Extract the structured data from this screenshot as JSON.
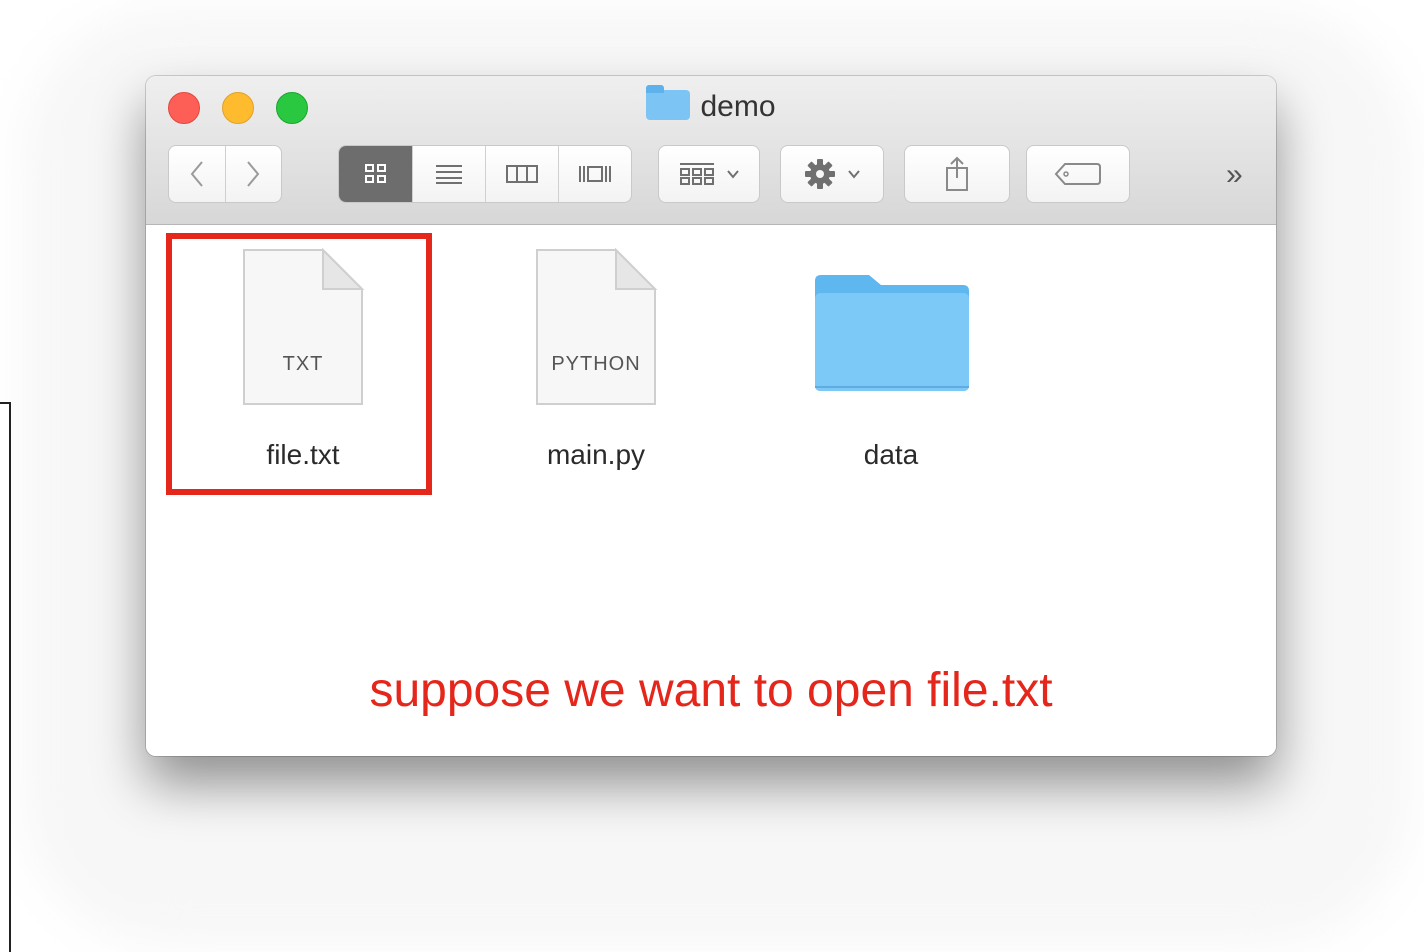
{
  "window": {
    "title": "demo"
  },
  "toolbar": {
    "back_icon": "chevron-left-icon",
    "forward_icon": "chevron-right-icon",
    "views": [
      "icon-view-icon",
      "list-view-icon",
      "column-view-icon",
      "cover-flow-view-icon"
    ],
    "active_view": "icon-view-icon",
    "arrange_icon": "arrange-grid-icon",
    "action_icon": "gear-icon",
    "share_icon": "share-icon",
    "tag_icon": "tag-icon",
    "overflow_label": "»"
  },
  "files": [
    {
      "name": "file.txt",
      "kind": "document",
      "type_label": "TXT",
      "selected": true
    },
    {
      "name": "main.py",
      "kind": "document",
      "type_label": "PYTHON",
      "selected": false
    },
    {
      "name": "data",
      "kind": "folder",
      "selected": false
    }
  ],
  "caption": "suppose we want to open file.txt",
  "colors": {
    "annotation_red": "#e4261b",
    "folder_blue": "#7bc4f4"
  }
}
